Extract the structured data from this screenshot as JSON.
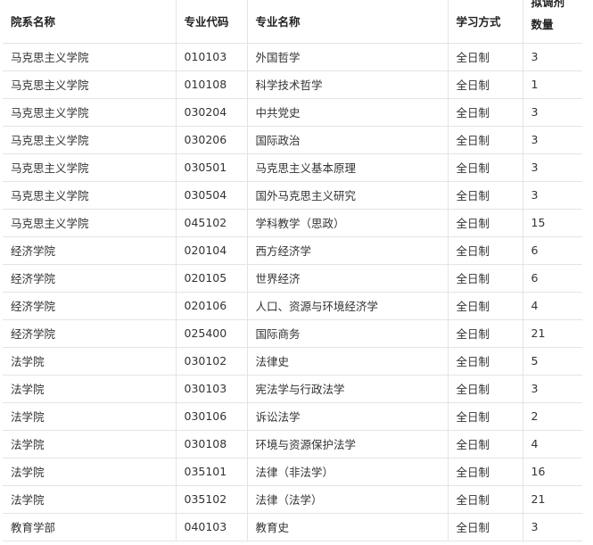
{
  "headers": {
    "department": "院系名称",
    "major_code": "专业代码",
    "major_name": "专业名称",
    "study_mode": "学习方式",
    "quota": "拟调剂数量"
  },
  "rows": [
    {
      "department": "马克思主义学院",
      "major_code": "010103",
      "major_name": "外国哲学",
      "study_mode": "全日制",
      "quota": "3"
    },
    {
      "department": "马克思主义学院",
      "major_code": "010108",
      "major_name": "科学技术哲学",
      "study_mode": "全日制",
      "quota": "1"
    },
    {
      "department": "马克思主义学院",
      "major_code": "030204",
      "major_name": "中共党史",
      "study_mode": "全日制",
      "quota": "3"
    },
    {
      "department": "马克思主义学院",
      "major_code": "030206",
      "major_name": "国际政治",
      "study_mode": "全日制",
      "quota": "3"
    },
    {
      "department": "马克思主义学院",
      "major_code": "030501",
      "major_name": "马克思主义基本原理",
      "study_mode": "全日制",
      "quota": "3"
    },
    {
      "department": "马克思主义学院",
      "major_code": "030504",
      "major_name": "国外马克思主义研究",
      "study_mode": "全日制",
      "quota": "3"
    },
    {
      "department": "马克思主义学院",
      "major_code": "045102",
      "major_name": "学科教学（思政）",
      "study_mode": "全日制",
      "quota": "15"
    },
    {
      "department": "经济学院",
      "major_code": "020104",
      "major_name": "西方经济学",
      "study_mode": "全日制",
      "quota": "6"
    },
    {
      "department": "经济学院",
      "major_code": "020105",
      "major_name": "世界经济",
      "study_mode": "全日制",
      "quota": "6"
    },
    {
      "department": "经济学院",
      "major_code": "020106",
      "major_name": "人口、资源与环境经济学",
      "study_mode": "全日制",
      "quota": "4"
    },
    {
      "department": "经济学院",
      "major_code": "025400",
      "major_name": "国际商务",
      "study_mode": "全日制",
      "quota": "21"
    },
    {
      "department": "法学院",
      "major_code": "030102",
      "major_name": "法律史",
      "study_mode": "全日制",
      "quota": "5"
    },
    {
      "department": "法学院",
      "major_code": "030103",
      "major_name": "宪法学与行政法学",
      "study_mode": "全日制",
      "quota": "3"
    },
    {
      "department": "法学院",
      "major_code": "030106",
      "major_name": "诉讼法学",
      "study_mode": "全日制",
      "quota": "2"
    },
    {
      "department": "法学院",
      "major_code": "030108",
      "major_name": "环境与资源保护法学",
      "study_mode": "全日制",
      "quota": "4"
    },
    {
      "department": "法学院",
      "major_code": "035101",
      "major_name": "法律（非法学）",
      "study_mode": "全日制",
      "quota": "16"
    },
    {
      "department": "法学院",
      "major_code": "035102",
      "major_name": "法律（法学）",
      "study_mode": "全日制",
      "quota": "21"
    },
    {
      "department": "教育学部",
      "major_code": "040103",
      "major_name": "教育史",
      "study_mode": "全日制",
      "quota": "3"
    }
  ]
}
